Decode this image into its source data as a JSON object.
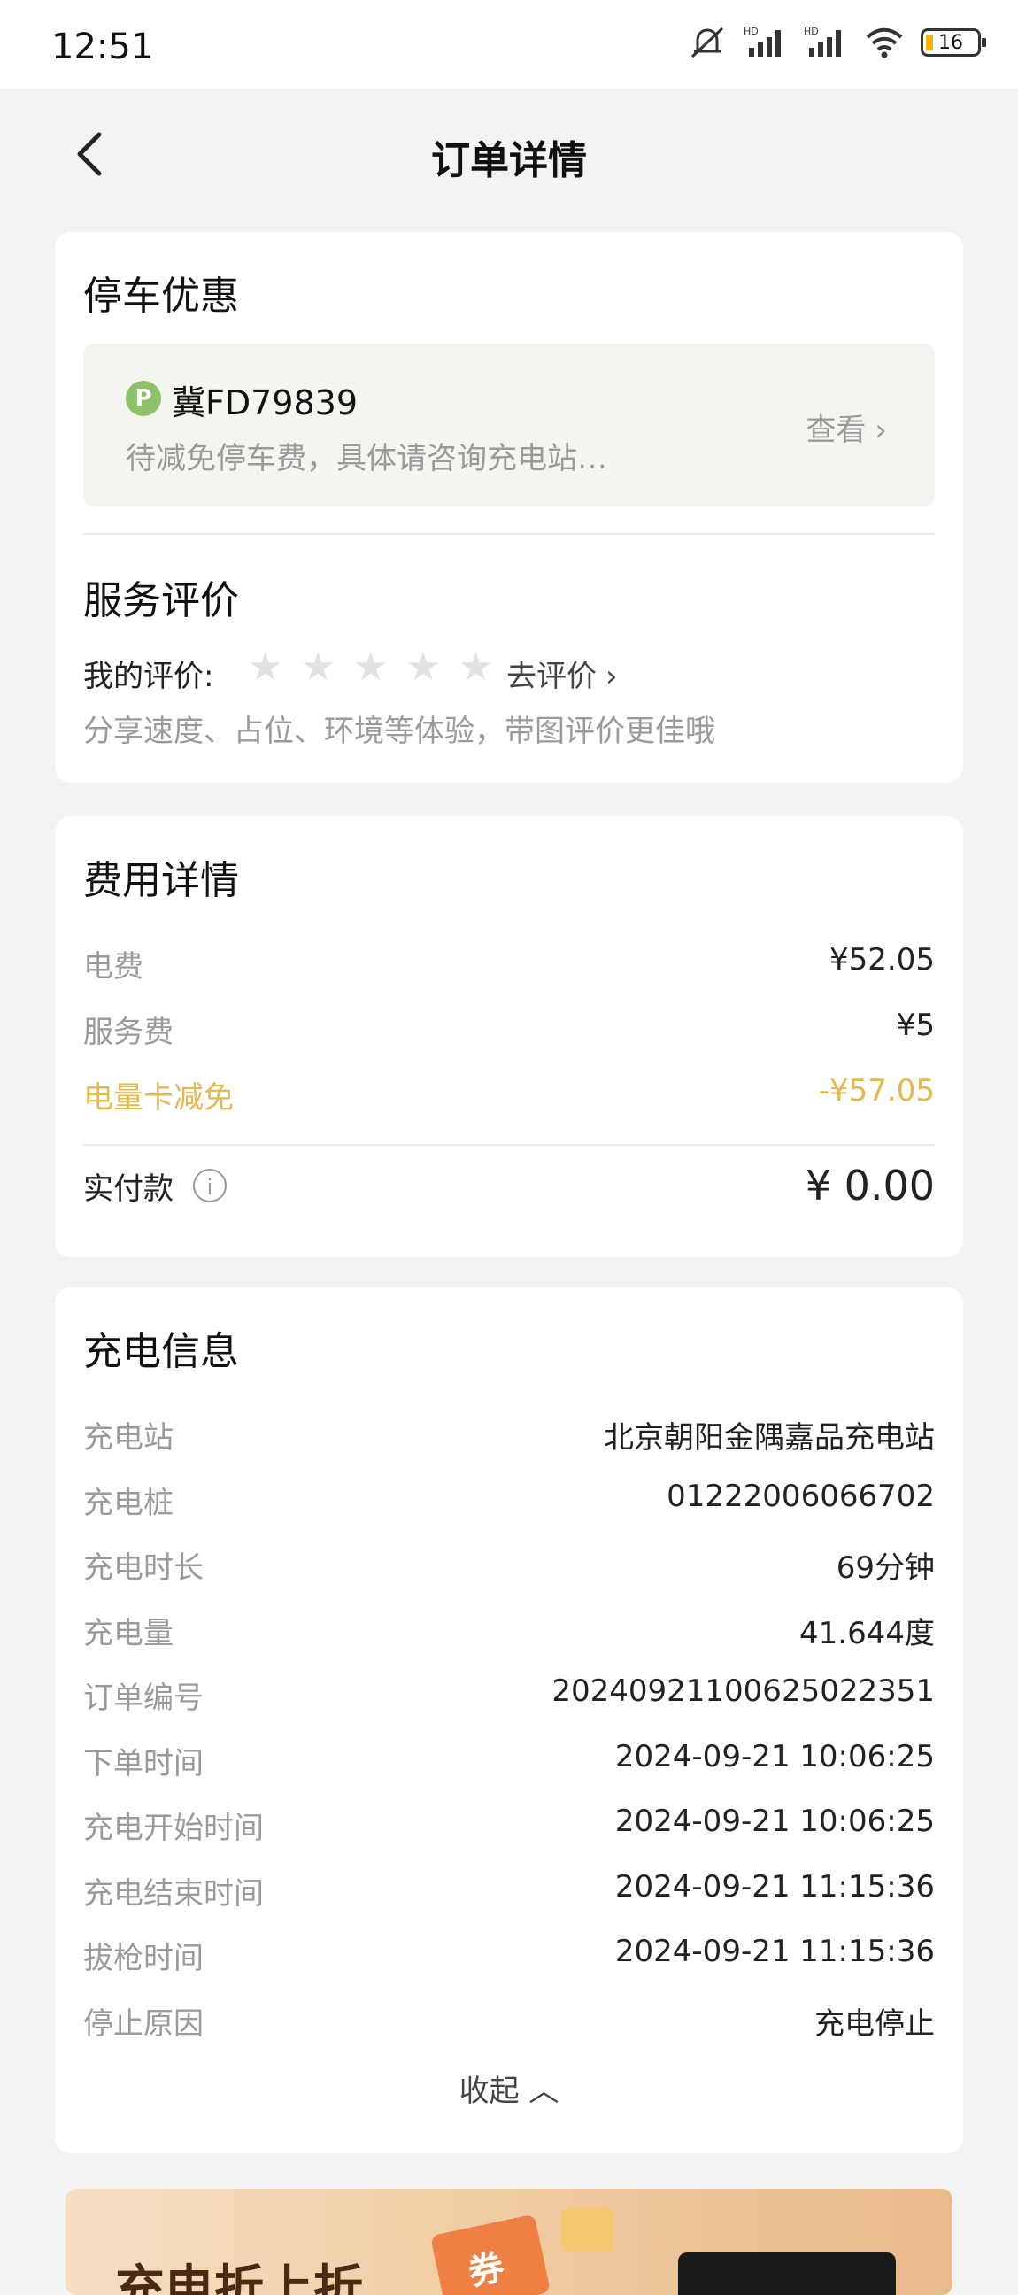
{
  "status": {
    "time": "12:51",
    "battery": "16"
  },
  "nav": {
    "title": "订单详情"
  },
  "parking": {
    "section_title": "停车优惠",
    "badge": "P",
    "plate": "冀FD79839",
    "desc": "待减免停车费，具体请咨询充电站…",
    "view_label": "查看",
    "chevron": "›"
  },
  "review": {
    "section_title": "服务评价",
    "my_rating_label": "我的评价:",
    "stars": [
      "★",
      "★",
      "★",
      "★",
      "★"
    ],
    "stars_rating": 0,
    "go_rate_label": "去评价",
    "chevron": "›",
    "hint": "分享速度、占位、环境等体验，带图评价更佳哦"
  },
  "fees": {
    "section_title": "费用详情",
    "rows": [
      {
        "label": "电费",
        "value": "¥52.05"
      },
      {
        "label": "服务费",
        "value": "¥5"
      },
      {
        "label": "电量卡减免",
        "value": "-¥57.05"
      }
    ],
    "paid_label": "实付款",
    "info_icon": "i",
    "paid_value": "¥ 0.00",
    "accent_color": "#e8b84a"
  },
  "charging": {
    "section_title": "充电信息",
    "rows": [
      {
        "label": "充电站",
        "value": "北京朝阳金隅嘉品充电站"
      },
      {
        "label": "充电桩",
        "value": "01222006066702"
      },
      {
        "label": "充电时长",
        "value": "69分钟"
      },
      {
        "label": "充电量",
        "value": "41.644度"
      },
      {
        "label": "订单编号",
        "value": "20240921100625022351"
      },
      {
        "label": "下单时间",
        "value": "2024-09-21 10:06:25"
      },
      {
        "label": "充电开始时间",
        "value": "2024-09-21 10:06:25"
      },
      {
        "label": "充电结束时间",
        "value": "2024-09-21 11:15:36"
      },
      {
        "label": "拔枪时间",
        "value": "2024-09-21 11:15:36"
      },
      {
        "label": "停止原因",
        "value": "充电停止"
      }
    ],
    "collapse_label": "收起",
    "collapse_icon": "︿"
  },
  "banner": {
    "text": "充电折上折",
    "coupon": "券"
  }
}
